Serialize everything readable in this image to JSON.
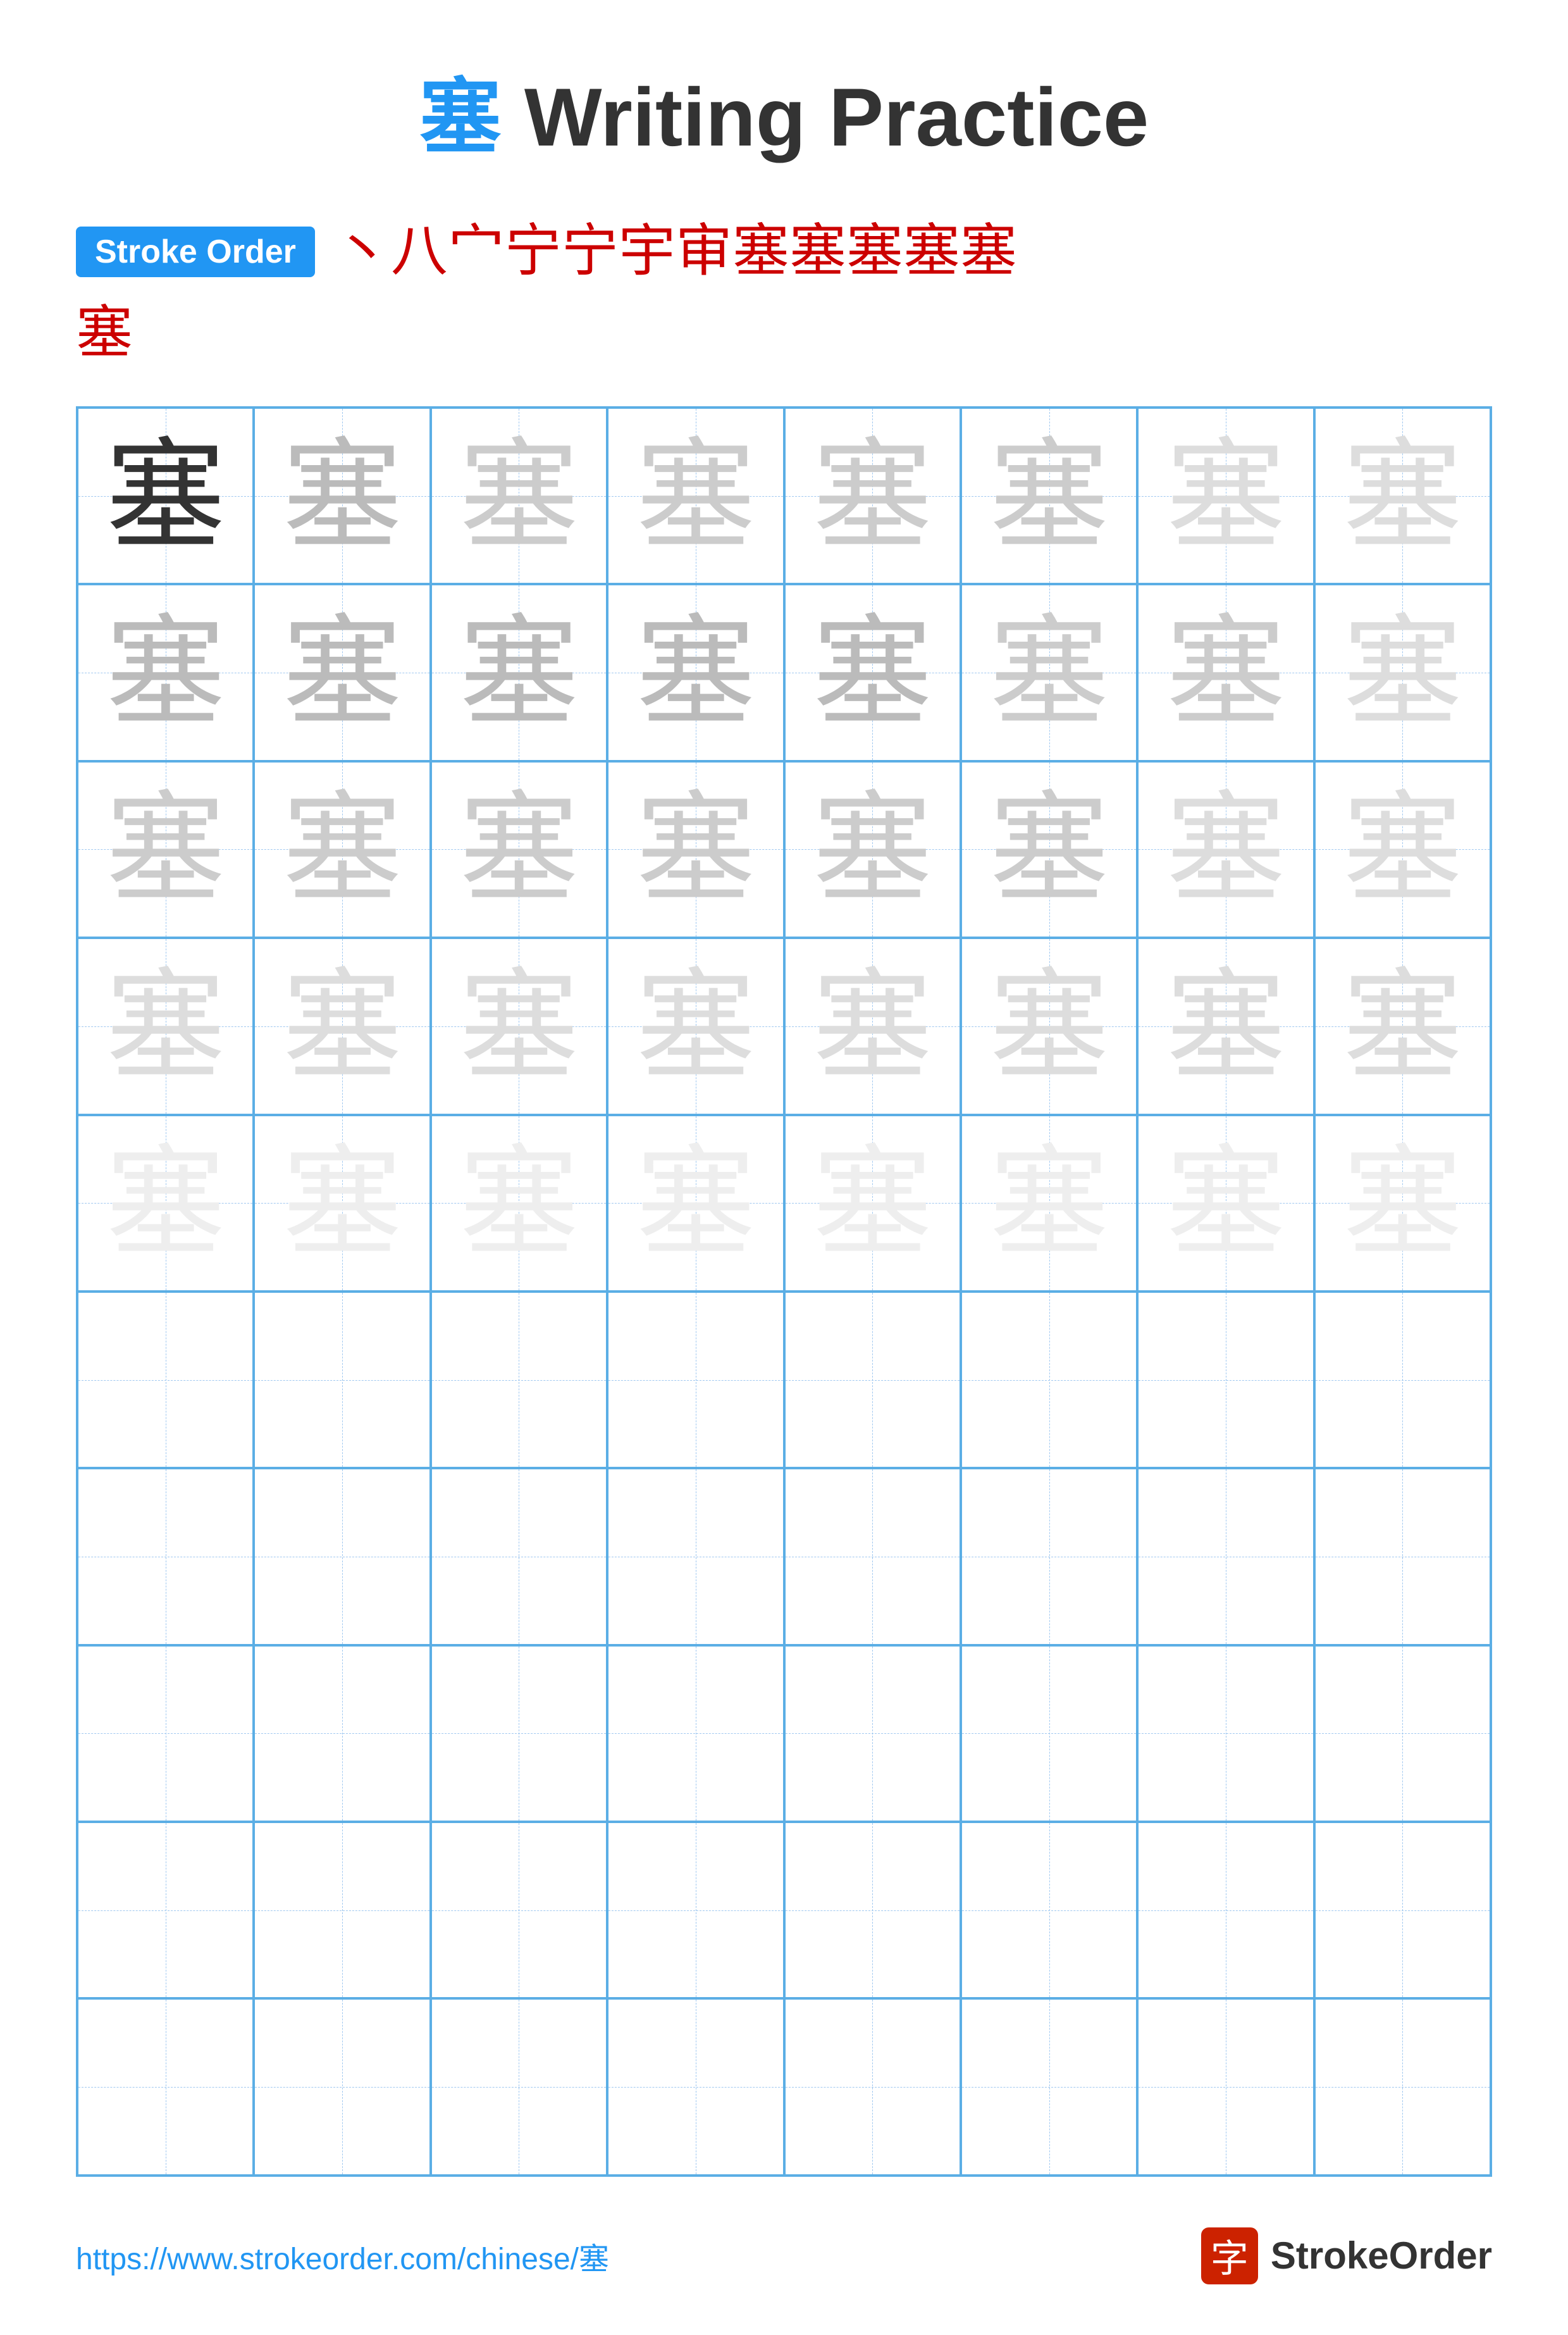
{
  "title": {
    "char": "塞",
    "rest": " Writing Practice"
  },
  "stroke_order": {
    "badge_label": "Stroke Order",
    "sequence": [
      "丶",
      "八",
      "宀",
      "宀",
      "宁",
      "宇",
      "审",
      "塞",
      "塞",
      "塞",
      "塞塞",
      "塞"
    ],
    "chars": [
      "丶",
      "八",
      "宀",
      "宁",
      "宁",
      "宁",
      "审",
      "塞",
      "塞",
      "塞",
      "塞",
      "塞"
    ]
  },
  "grid": {
    "rows": 10,
    "cols": 8,
    "char": "塞"
  },
  "footer": {
    "url": "https://www.strokeorder.com/chinese/塞",
    "brand": "StrokeOrder",
    "icon_char": "字"
  }
}
